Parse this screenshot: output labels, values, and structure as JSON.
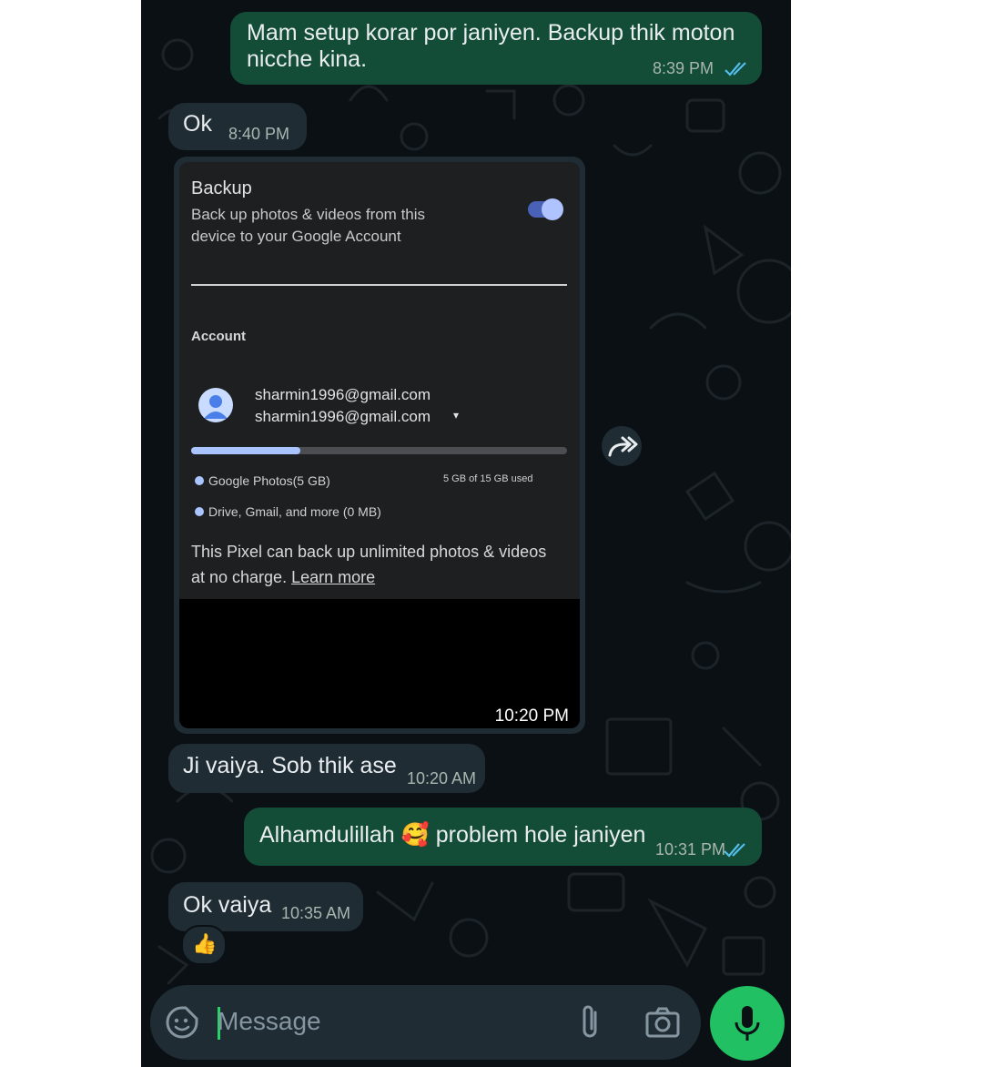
{
  "messages": [
    {
      "dir": "out",
      "text": "Mam setup korar por janiyen. Backup thik moton nicche kina.",
      "line1": "Mam setup korar por janiyen. Backup thik moton",
      "line2": "nicche kina.",
      "time": "8:39 PM",
      "status": "read"
    },
    {
      "dir": "in",
      "text": "Ok",
      "time": "8:40 PM"
    },
    {
      "dir": "in",
      "type": "image",
      "time": "10:20 PM"
    },
    {
      "dir": "in",
      "text": "Ji vaiya. Sob thik ase",
      "time": "10:20 AM"
    },
    {
      "dir": "out",
      "text_before": "Alhamdulillah",
      "emoji": "🥰",
      "text_after": "problem hole janiyen",
      "time": "10:31 PM",
      "status": "read"
    },
    {
      "dir": "in",
      "text": "Ok vaiya",
      "time": "10:35 AM",
      "reaction": "👍"
    }
  ],
  "shared_screenshot": {
    "title": "Backup",
    "description": "Back up photos & videos from this device to your Google Account",
    "backup_enabled": true,
    "account_label": "Account",
    "email_primary": "sharmin1996@gmail.com",
    "email_secondary": "sharmin1996@gmail.com",
    "caret": "▾",
    "storage_used_fraction": 0.29,
    "legend_photos": "Google Photos(5 GB)",
    "storage_used": "5 GB of 15 GB used",
    "legend_other": "Drive, Gmail, and more (0 MB)",
    "note_line1": "This Pixel can back up unlimited photos & videos",
    "note_line2": "at no charge.",
    "learn_more": "Learn more"
  },
  "input": {
    "placeholder": "Message"
  },
  "colors": {
    "background": "#0b1014",
    "outgoing_bubble": "#144d37",
    "incoming_bubble": "#1f2c34",
    "read_ticks": "#53bdeb",
    "mic_button": "#21c063",
    "accent_cursor": "#25d366"
  },
  "icons": [
    "forward-icon",
    "sticker-icon",
    "attach-icon",
    "camera-icon",
    "mic-icon",
    "read-ticks-icon"
  ]
}
